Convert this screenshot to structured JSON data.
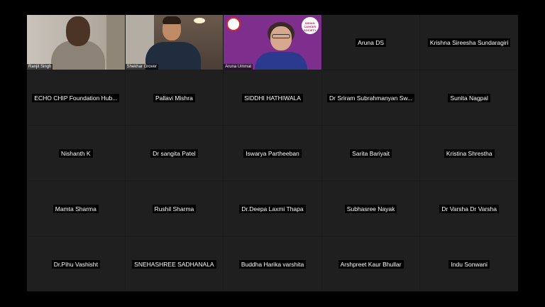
{
  "video_participants": [
    {
      "name": "Ranjit Singh"
    },
    {
      "name": "Shekhar Grover"
    },
    {
      "name": "Aruna Ummat"
    }
  ],
  "logo_text": "INDIAN CANCER SOCIETY",
  "participants": [
    "Aruna DS",
    "Krishna Sireesha Sundaragiri",
    "ECHO CHIP Foundation Hub...",
    "Pallavi Mishra",
    "SIDDHI HATHIWALA",
    "Dr Sriram Subrahmanyan Sw...",
    "Sunita Nagpal",
    "Nishanth K",
    "Dr sangita Patel",
    "Iswarya Partheeban",
    "Sarita Bariyait",
    "Kristina Shrestha",
    "Mamta Sharma",
    "Rushil Sharma",
    "Dr.Deepa Laxmi Thapa",
    "Subhasree Nayak",
    "Dr Varsha Dr Varsha",
    "Dr.Pihu Vashisht",
    "SNEHASHREE SADHANALA",
    "Buddha Harika varshita",
    "Arshpreet Kaur Bhullar",
    "Indu Sonwani"
  ]
}
